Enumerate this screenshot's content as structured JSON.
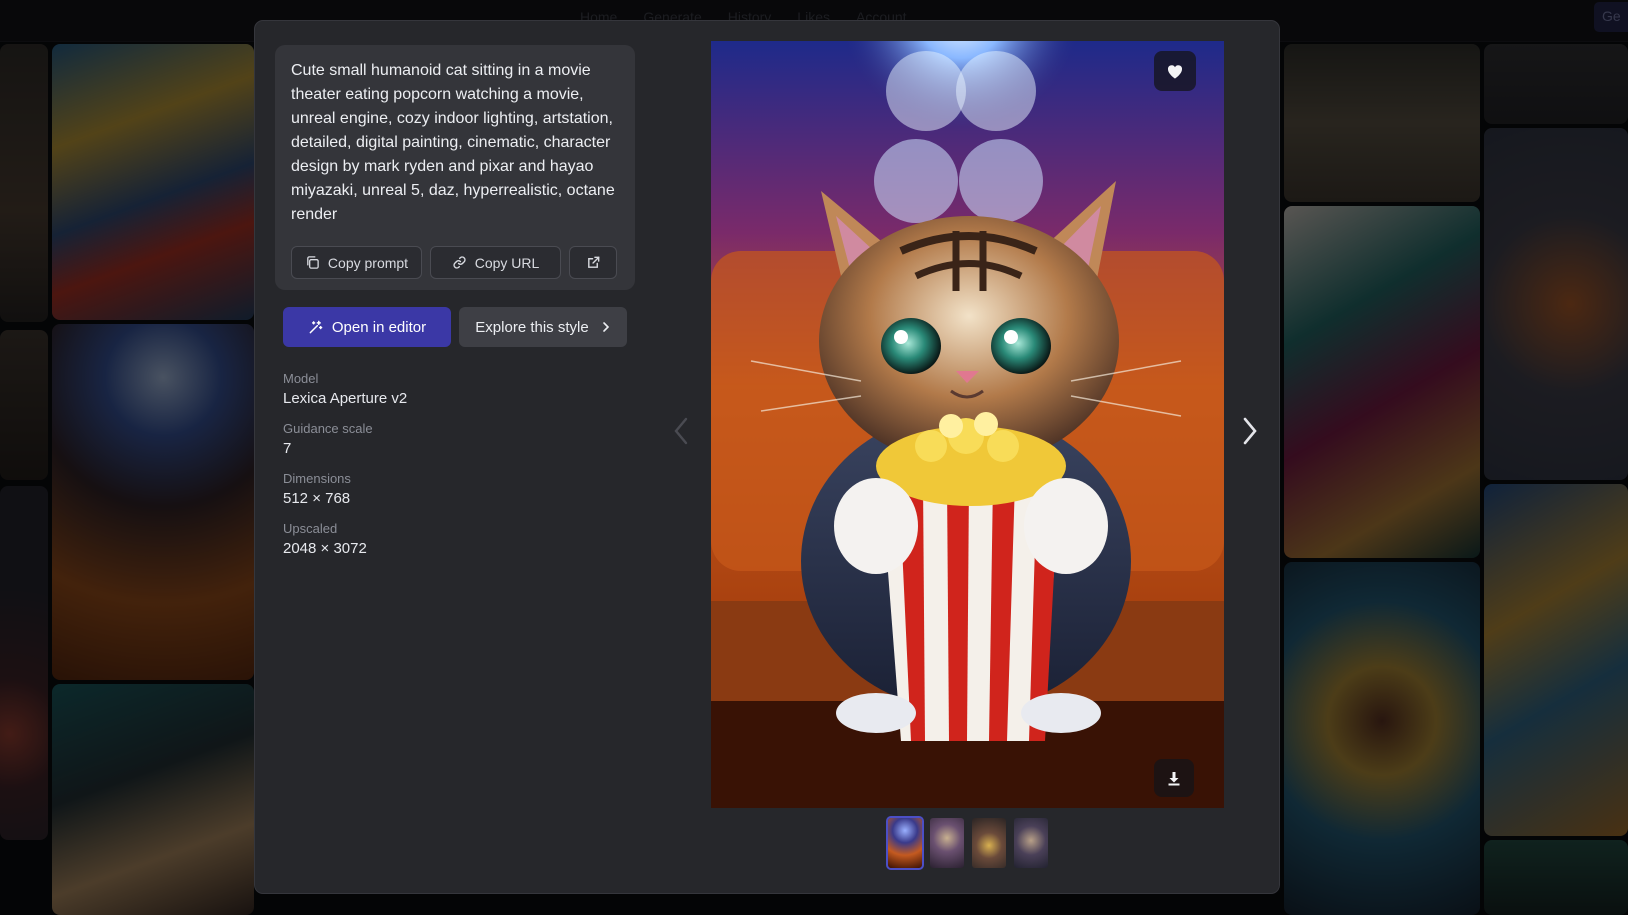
{
  "nav": {
    "links": [
      "Home",
      "Generate",
      "History",
      "Likes",
      "Account"
    ],
    "get_button": "Ge"
  },
  "prompt": {
    "text": "Cute small humanoid cat sitting in a movie theater eating popcorn watching a movie, unreal engine, cozy indoor lighting, artstation, detailed, digital painting, cinematic, character design by mark ryden and pixar and hayao miyazaki, unreal 5, daz, hyperrealistic, octane render",
    "copy_prompt_label": "Copy prompt",
    "copy_url_label": "Copy URL"
  },
  "actions": {
    "open_editor_label": "Open in editor",
    "explore_style_label": "Explore this style"
  },
  "meta": [
    {
      "label": "Model",
      "value": "Lexica Aperture v2"
    },
    {
      "label": "Guidance scale",
      "value": "7"
    },
    {
      "label": "Dimensions",
      "value": "512 × 768"
    },
    {
      "label": "Upscaled",
      "value": "2048 × 3072"
    }
  ],
  "icons": {
    "like": "heart-icon",
    "download": "download-icon",
    "prev": "chevron-left-icon",
    "next": "chevron-right-icon",
    "copy": "copy-icon",
    "link": "link-icon",
    "external": "external-link-icon",
    "wand": "magic-wand-icon"
  },
  "colors": {
    "primary": "#3b38a6",
    "modal_bg": "#26272b",
    "card_bg": "#34353a"
  },
  "thumbnails": {
    "count": 4,
    "active_index": 0
  }
}
